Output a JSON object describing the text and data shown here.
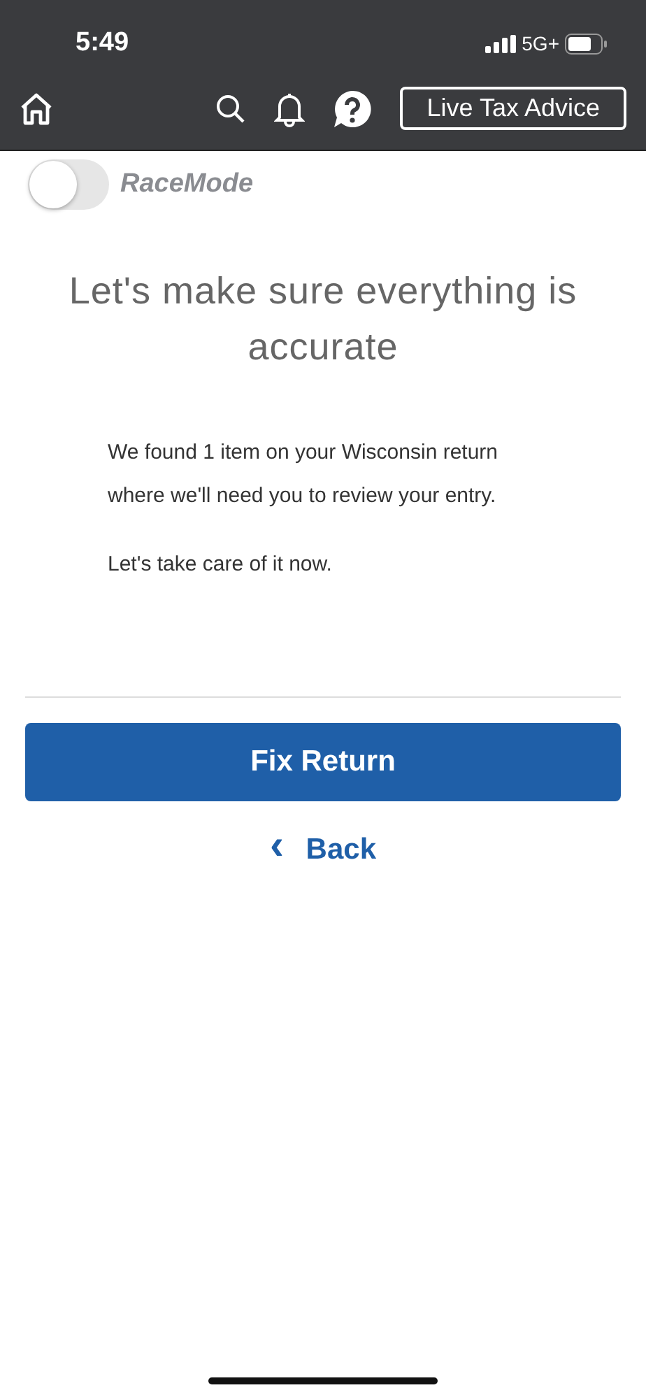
{
  "status_bar": {
    "time": "5:49",
    "network": "5G+"
  },
  "nav": {
    "advice_button": "Live Tax Advice"
  },
  "race_mode": {
    "label": "RaceMode",
    "on": false
  },
  "heading": "Let's make sure everything is accurate",
  "paragraphs": [
    "We found 1 item on your Wisconsin return where we'll need you to review your entry.",
    "Let's take care of it now."
  ],
  "primary_button": "Fix Return",
  "back_link": {
    "icon": "‹",
    "label": "Back"
  }
}
